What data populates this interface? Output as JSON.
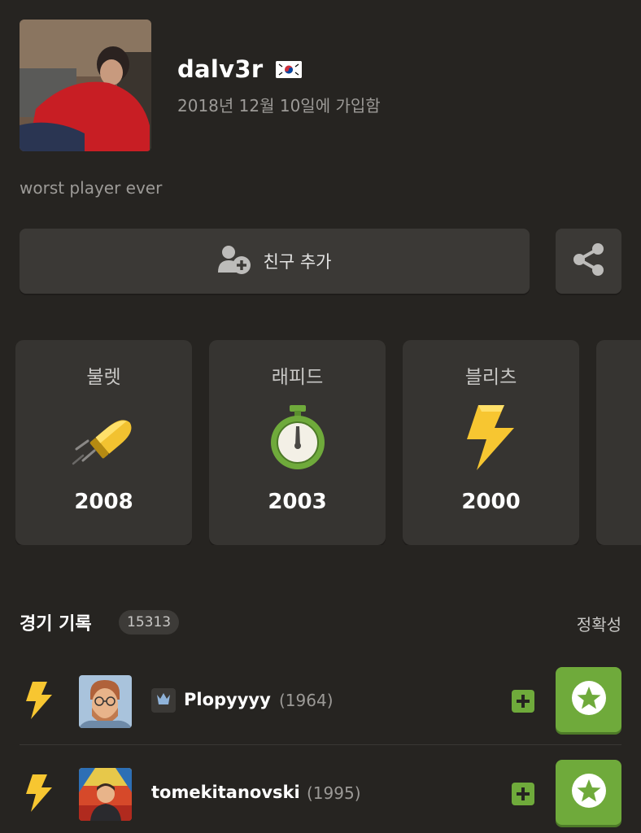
{
  "profile": {
    "username": "dalv3r",
    "flag_icon": "south-korea-flag-icon",
    "joined": "2018년 12월 10일에 가입함",
    "bio": "worst player ever"
  },
  "actions": {
    "add_friend_label": "친구 추가",
    "add_friend_icon": "add-user-icon",
    "share_icon": "share-icon"
  },
  "ratings": [
    {
      "name": "불렛",
      "icon": "bullet-icon",
      "rating": "2008"
    },
    {
      "name": "래피드",
      "icon": "stopwatch-icon",
      "rating": "2003"
    },
    {
      "name": "블리츠",
      "icon": "lightning-icon",
      "rating": "2000"
    }
  ],
  "games": {
    "title": "경기 기록",
    "count": "15313",
    "accuracy_label": "정확성",
    "rows": [
      {
        "mode_icon": "lightning-icon",
        "opponent": "Plopyyyy",
        "opponent_rating": "(1964)",
        "has_title_badge": true,
        "result_icon": "star-icon"
      },
      {
        "mode_icon": "lightning-icon",
        "opponent": "tomekitanovski",
        "opponent_rating": "(1995)",
        "has_title_badge": false,
        "result_icon": "star-icon"
      }
    ]
  },
  "colors": {
    "background": "#262421",
    "card": "#363431",
    "button": "#3b3936",
    "accent_green": "#6faa3b",
    "muted_text": "#9c9a97"
  }
}
